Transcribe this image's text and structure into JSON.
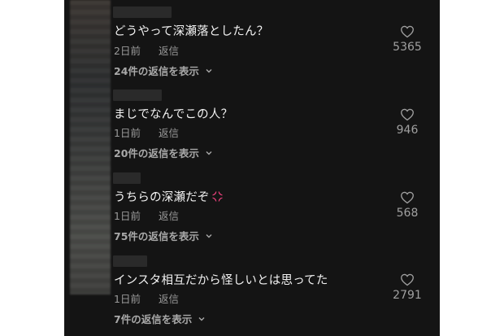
{
  "comments": [
    {
      "text": "どうやって深瀬落としたん？",
      "time": "2日前",
      "reply_label": "返信",
      "replies_label": "24件の返信を表示",
      "likes": "5365"
    },
    {
      "text": "まじでなんでこの人？",
      "time": "1日前",
      "reply_label": "返信",
      "replies_label": "20件の返信を表示",
      "likes": "946"
    },
    {
      "text": "うちらの深瀬だぞ",
      "time": "1日前",
      "reply_label": "返信",
      "replies_label": "75件の返信を表示",
      "likes": "568",
      "emoji": "anger-symbol-icon"
    },
    {
      "text": "インスタ相互だから怪しいとは思ってた",
      "time": "1日前",
      "reply_label": "返信",
      "replies_label": "7件の返信を表示",
      "likes": "2791"
    }
  ],
  "colors": {
    "background": "#141414",
    "text": "#f2f2f2",
    "meta": "#9a9a9a",
    "emoji": "#e8407a"
  },
  "icons": {
    "like": "heart-outline-icon",
    "expand": "chevron-down-icon"
  }
}
